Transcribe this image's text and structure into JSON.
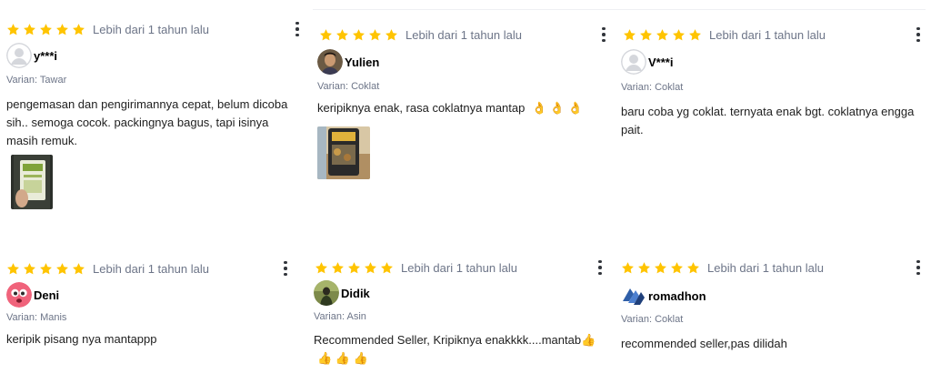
{
  "reviews": [
    {
      "rating": 5,
      "time": "Lebih dari 1 tahun lalu",
      "user": "y***i",
      "avatar": "default-avatar",
      "variant": "Varian: Tawar",
      "text": "pengemasan dan pengirimannya cepat, belum dicoba sih.. semoga cocok. packingnya bagus, tapi isinya masih remuk.",
      "has_photo": true
    },
    {
      "rating": 5,
      "time": "Lebih dari 1 tahun lalu",
      "user": "Yulien",
      "avatar": "photo-avatar",
      "variant": "Varian: Coklat",
      "text": "keripiknya enak, rasa coklatnya mantap",
      "emojis": "👌 👌 👌",
      "has_photo": true
    },
    {
      "rating": 5,
      "time": "Lebih dari 1 tahun lalu",
      "user": "V***i",
      "avatar": "default-avatar",
      "variant": "Varian: Coklat",
      "text": "baru coba yg coklat. ternyata enak bgt. coklatnya engga pait.",
      "has_photo": false
    },
    {
      "rating": 5,
      "time": "Lebih dari 1 tahun lalu",
      "user": "Deni",
      "avatar": "emoji-avatar",
      "variant": "Varian: Manis",
      "text": "keripik pisang nya mantappp",
      "has_photo": false
    },
    {
      "rating": 5,
      "time": "Lebih dari 1 tahun lalu",
      "user": "Didik",
      "avatar": "photo-avatar",
      "variant": "Varian: Asin",
      "text": "Recommended Seller, Kripiknya enakkkk....mantab",
      "emojis_inline": "👍",
      "emojis": "👍 👍 👍",
      "has_photo": false
    },
    {
      "rating": 5,
      "time": "Lebih dari 1 tahun lalu",
      "user": "romadhon",
      "avatar": "logo-avatar",
      "variant": "Varian: Coklat",
      "text": "recommended seller,pas dilidah",
      "has_photo": false
    }
  ],
  "colors": {
    "star": "#ffc400",
    "text": "#212121",
    "muted": "#6d7588"
  }
}
